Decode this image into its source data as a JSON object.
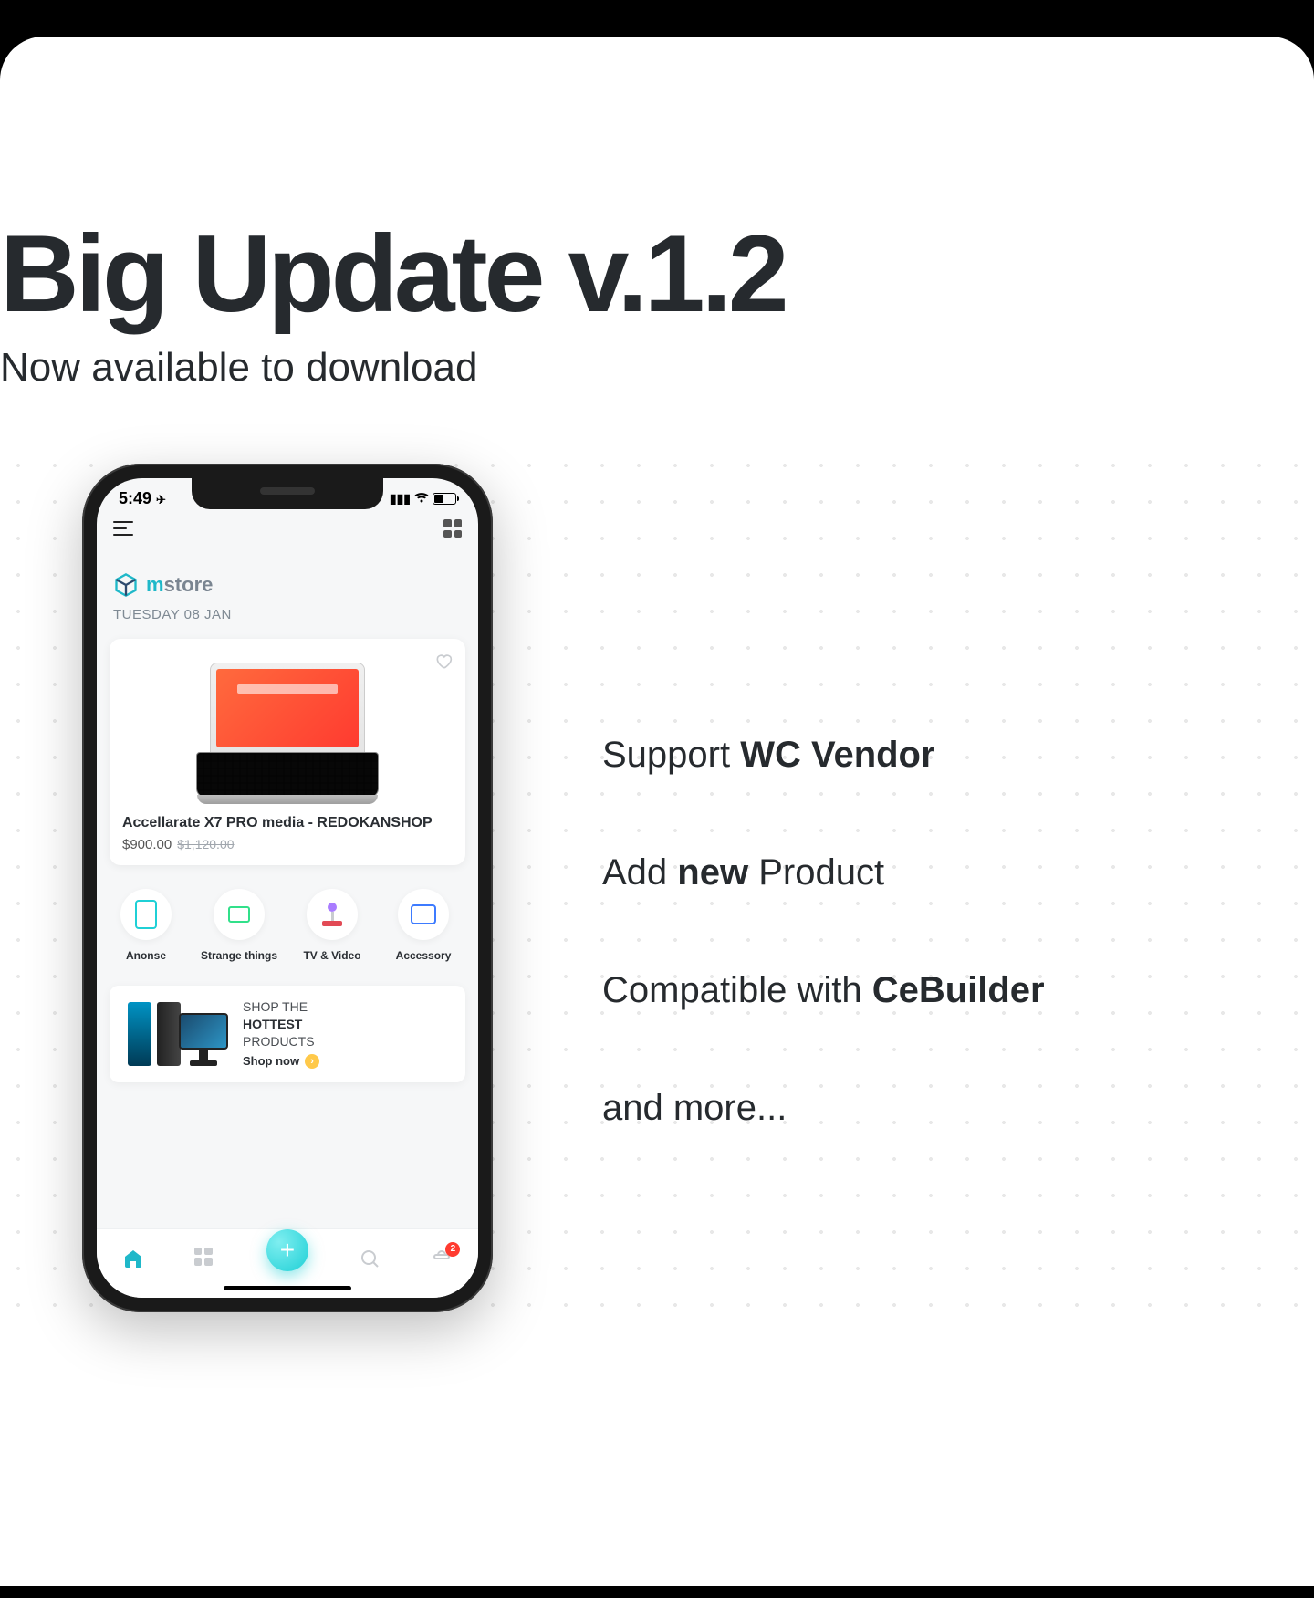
{
  "hero": {
    "title": "Big Update v.1.2",
    "subtitle": "Now available to download"
  },
  "phone": {
    "status_time": "5:49",
    "logo_m": "m",
    "logo_rest": "store",
    "date": "TUESDAY 08 JAN",
    "product": {
      "title": "Accellarate X7 PRO media  - REDOKANSHOP",
      "price": "$900.00",
      "old_price": "$1,120.00"
    },
    "categories": [
      {
        "label": "Anonse",
        "color": "#1fd0d6"
      },
      {
        "label": "Strange things",
        "color": "#31e08a"
      },
      {
        "label": "TV & Video",
        "color": "#a97cff"
      },
      {
        "label": "Accessory",
        "color": "#3d7bff"
      }
    ],
    "promo": {
      "line1": "SHOP THE",
      "line2": "HOTTEST",
      "line3": "PRODUCTS",
      "cta": "Shop now"
    },
    "badge": "2"
  },
  "features": {
    "f1_pre": "Support ",
    "f1_bold": "WC Vendor",
    "f2_pre": "Add ",
    "f2_bold": "new",
    "f2_post": " Product",
    "f3_pre": "Compatible with ",
    "f3_bold": "CeBuilder",
    "f4": "and more..."
  }
}
